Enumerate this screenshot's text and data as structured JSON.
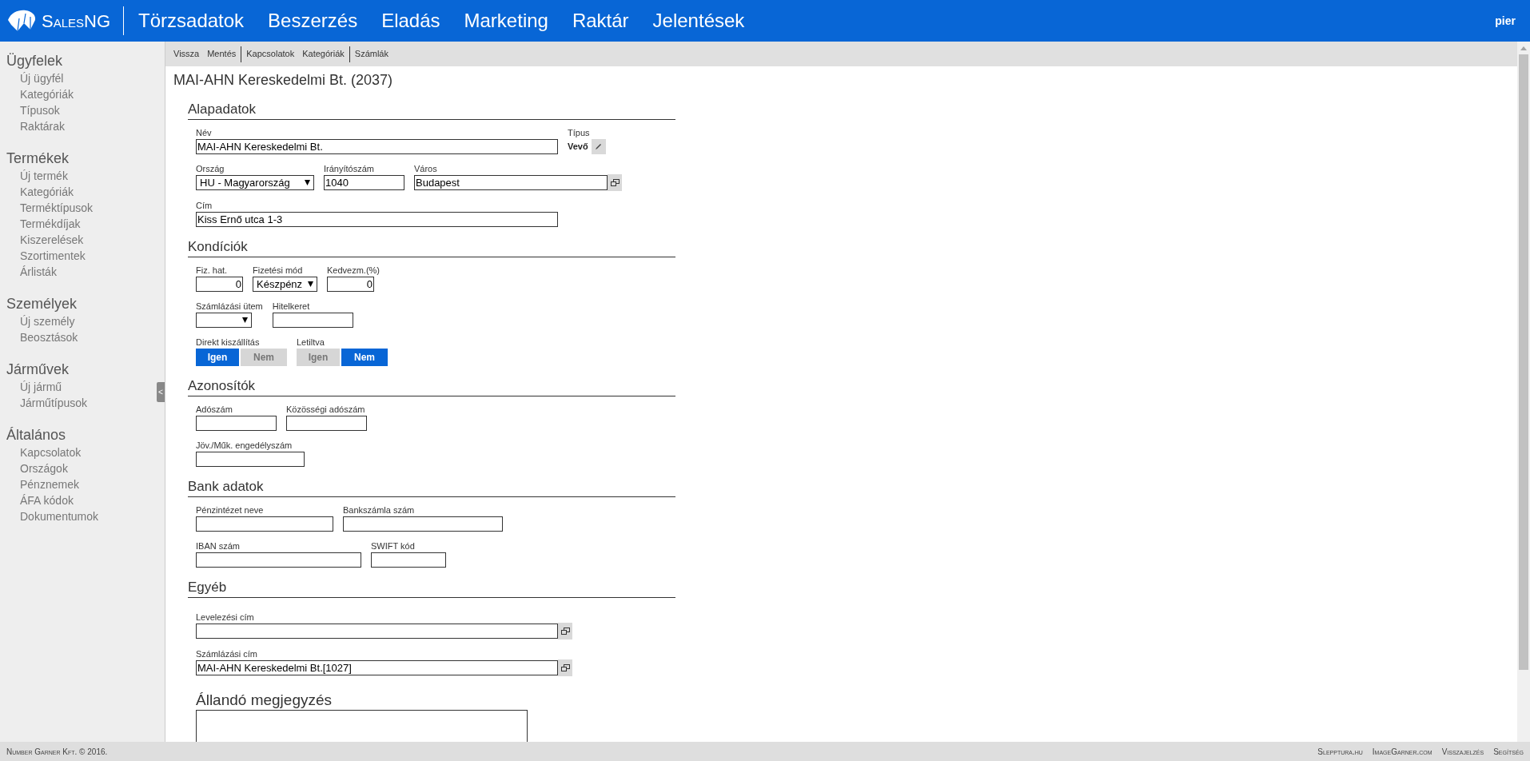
{
  "header": {
    "logo_text": "SalesNG",
    "nav": [
      "Törzsadatok",
      "Beszerzés",
      "Eladás",
      "Marketing",
      "Raktár",
      "Jelentések"
    ],
    "user": "pier"
  },
  "sidebar": {
    "groups": [
      {
        "title": "Ügyfelek",
        "items": [
          "Új ügyfél",
          "Kategóriák",
          "Típusok",
          "Raktárak"
        ]
      },
      {
        "title": "Termékek",
        "items": [
          "Új termék",
          "Kategóriák",
          "Terméktípusok",
          "Termékdíjak",
          "Kiszerelések",
          "Szortimentek",
          "Árlisták"
        ]
      },
      {
        "title": "Személyek",
        "items": [
          "Új személy",
          "Beosztások"
        ]
      },
      {
        "title": "Járművek",
        "items": [
          "Új jármű",
          "Járműtípusok"
        ]
      },
      {
        "title": "Általános",
        "items": [
          "Kapcsolatok",
          "Országok",
          "Pénznemek",
          "ÁFA kódok",
          "Dokumentumok"
        ]
      }
    ],
    "collapse_handle": "<"
  },
  "toolbar": {
    "groups": [
      [
        "Vissza",
        "Mentés"
      ],
      [
        "Kapcsolatok",
        "Kategóriák"
      ],
      [
        "Számlák"
      ]
    ]
  },
  "title": "MAI-AHN Kereskedelmi Bt. (2037)",
  "sections": [
    {
      "title": "Alapadatok",
      "rows": [
        {
          "fields": [
            {
              "kind": "text",
              "label": "Név",
              "value": "MAI-AHN Kereskedelmi Bt."
            },
            {
              "kind": "type",
              "label": "Típus",
              "value": "Vevő"
            }
          ]
        },
        {
          "fields": [
            {
              "kind": "select",
              "label": "Ország",
              "value": "HU - Magyarország"
            },
            {
              "kind": "text",
              "label": "Irányítószám",
              "value": "1040"
            },
            {
              "kind": "lookup",
              "label": "Város",
              "value": "Budapest"
            }
          ]
        },
        {
          "fields": [
            {
              "kind": "text",
              "label": "Cím",
              "value": "Kiss Ernő utca 1-3"
            }
          ]
        }
      ]
    },
    {
      "title": "Kondíciók",
      "rows": [
        {
          "fields": [
            {
              "kind": "number",
              "label": "Fiz. hat.",
              "value": "0"
            },
            {
              "kind": "select",
              "label": "Fizetési mód",
              "value": "Készpénz"
            },
            {
              "kind": "number",
              "label": "Kedvezm.(%)",
              "value": "0"
            }
          ]
        },
        {
          "fields": [
            {
              "kind": "select",
              "label": "Számlázási ütem"
            },
            {
              "kind": "text",
              "label": "Hitelkeret"
            }
          ]
        },
        {
          "fields": [
            {
              "kind": "toggle",
              "label": "Direkt kiszállítás",
              "options": [
                {
                  "label": "Igen",
                  "selected": true
                },
                {
                  "label": "Nem",
                  "selected": false
                }
              ]
            },
            {
              "kind": "toggle",
              "label": "Letiltva",
              "options": [
                {
                  "label": "Igen",
                  "selected": false
                },
                {
                  "label": "Nem",
                  "selected": true
                }
              ]
            }
          ]
        }
      ]
    },
    {
      "title": "Azonosítók",
      "rows": [
        {
          "fields": [
            {
              "kind": "text",
              "label": "Adószám"
            },
            {
              "kind": "text",
              "label": "Közösségi adószám"
            }
          ]
        },
        {
          "fields": [
            {
              "kind": "text",
              "label": "Jöv./Műk. engedélyszám"
            }
          ]
        }
      ]
    },
    {
      "title": "Bank adatok",
      "rows": [
        {
          "fields": [
            {
              "kind": "text",
              "label": "Pénzintézet neve"
            },
            {
              "kind": "text",
              "label": "Bankszámla szám"
            }
          ]
        },
        {
          "fields": [
            {
              "kind": "text",
              "label": "IBAN szám"
            },
            {
              "kind": "text",
              "label": "SWIFT kód"
            }
          ]
        }
      ]
    },
    {
      "title": "Egyéb",
      "rows": [
        {
          "fields": [
            {
              "kind": "lookup",
              "label": "Levelezési cím"
            }
          ]
        },
        {
          "fields": [
            {
              "kind": "lookup",
              "label": "Számlázási cím",
              "value": "MAI-AHN Kereskedelmi Bt.[1027]"
            }
          ]
        }
      ]
    }
  ],
  "notes": {
    "title": "Állandó megjegyzés"
  },
  "footer": {
    "copyright": "Number Garner Kft. © 2016.",
    "links": [
      "Slepptura.hu",
      "ImageGarner.com",
      "Visszajelzés",
      "Segítség"
    ]
  }
}
